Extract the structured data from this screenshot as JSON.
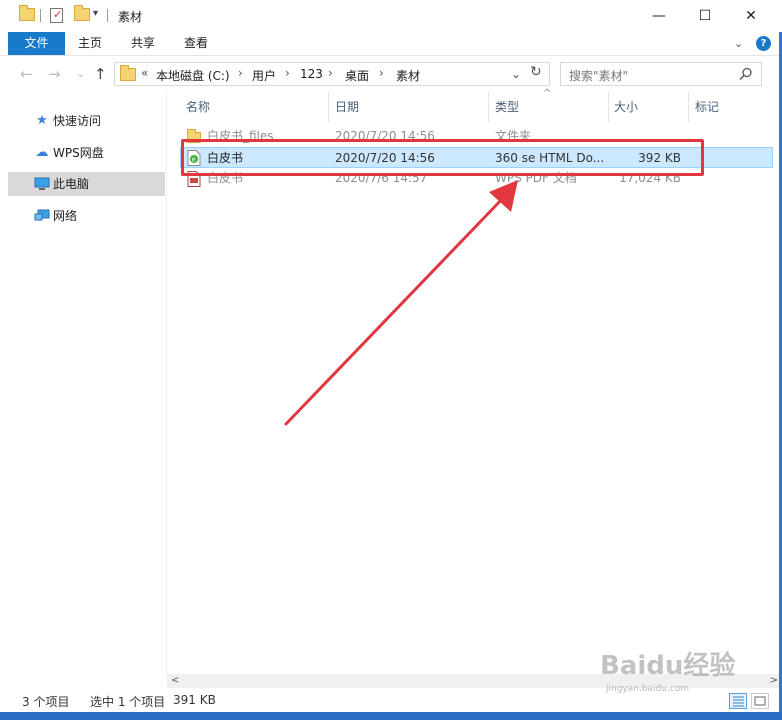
{
  "window": {
    "title": "素材"
  },
  "ribbon": {
    "tabs": [
      "文件",
      "主页",
      "共享",
      "查看"
    ],
    "expand_glyph": "⌄",
    "help_glyph": "?"
  },
  "titlebar": {
    "minimize": "—",
    "maximize": "☐",
    "close": "✕"
  },
  "nav": {
    "back": "←",
    "forward": "→",
    "recent": "⌄",
    "up": "↑"
  },
  "address": {
    "lead": "«",
    "crumbs": [
      "本地磁盘 (C:)",
      "用户",
      "123",
      "桌面",
      "素材"
    ],
    "separator": "›",
    "dropdown": "⌄",
    "refresh": "↻"
  },
  "search": {
    "placeholder": "搜索\"素材\"",
    "icon": "search-icon"
  },
  "sidebar": {
    "items": [
      {
        "label": "快速访问",
        "icon": "star-icon"
      },
      {
        "label": "WPS网盘",
        "icon": "cloud-icon"
      },
      {
        "label": "此电脑",
        "icon": "computer-icon"
      },
      {
        "label": "网络",
        "icon": "network-icon"
      }
    ]
  },
  "columns": [
    "名称",
    "日期",
    "类型",
    "大小",
    "标记"
  ],
  "files": [
    {
      "name": "白皮书_files",
      "date": "2020/7/20 14:56",
      "type": "文件夹",
      "size": "",
      "icon": "folder-icon"
    },
    {
      "name": "白皮书",
      "date": "2020/7/20 14:56",
      "type": "360 se HTML Do...",
      "size": "392 KB",
      "icon": "html-file-icon"
    },
    {
      "name": "白皮书",
      "date": "2020/7/6 14:57",
      "type": "WPS PDF 文档",
      "size": "17,024 KB",
      "icon": "pdf-file-icon"
    }
  ],
  "status": {
    "count": "3 个项目",
    "selected": "选中 1 个项目",
    "selected_size": "391 KB"
  },
  "watermark": {
    "text": "Baidu经验",
    "sub": "jingyan.baidu.com"
  },
  "colors": {
    "accent": "#1979ca",
    "selection": "#cce8ff",
    "highlight": "#e0383e"
  }
}
